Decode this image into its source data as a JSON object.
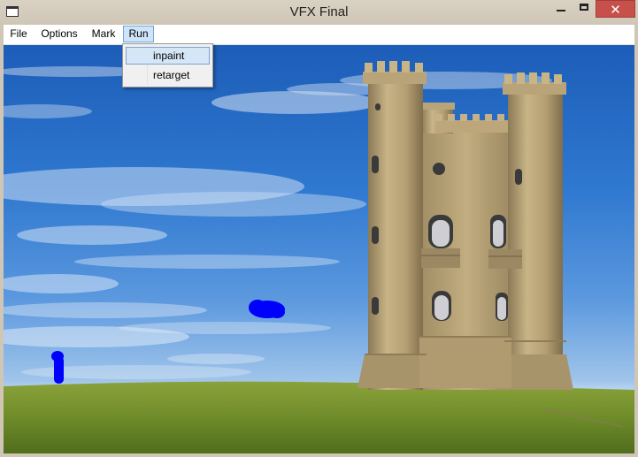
{
  "window": {
    "title": "VFX Final",
    "close_glyph": "✕"
  },
  "menubar": {
    "items": [
      {
        "label": "File"
      },
      {
        "label": "Options"
      },
      {
        "label": "Mark"
      },
      {
        "label": "Run"
      }
    ],
    "active": "Run"
  },
  "dropdown": {
    "items": [
      {
        "label": "inpaint",
        "highlighted": true
      },
      {
        "label": "retarget",
        "highlighted": false
      }
    ]
  },
  "canvas": {
    "scene": "castle-tower-on-grassy-hill",
    "mark_color": "#0000ff"
  },
  "colors": {
    "close_button": "#c7504a",
    "menu_highlight": "#cfe4fa",
    "titlebar": "#cfc6b6"
  }
}
